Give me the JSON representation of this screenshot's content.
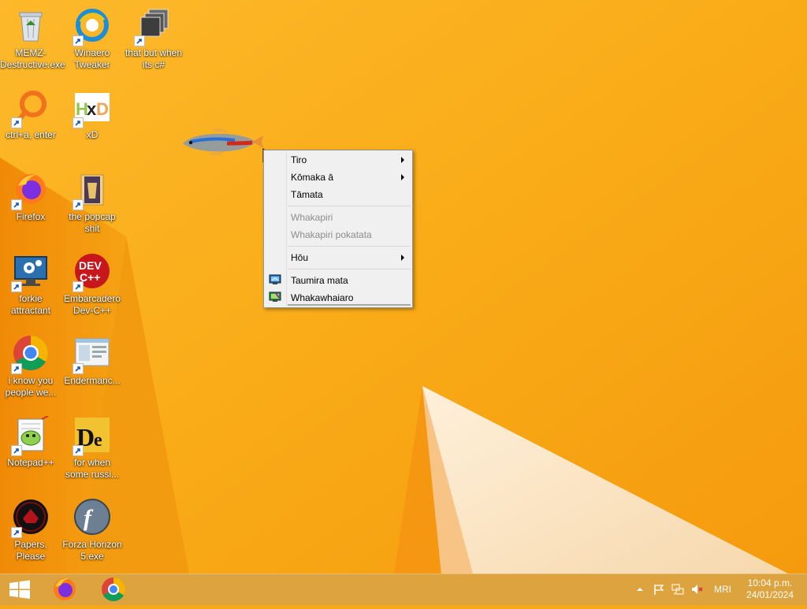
{
  "desktop": {
    "icons": [
      {
        "label": "MEMZ-Destructive.exe",
        "icon": "recycle-bin-icon"
      },
      {
        "label": "Winaero Tweaker",
        "icon": "winaero-icon"
      },
      {
        "label": "that but when its c#",
        "icon": "stacked-windows-icon"
      },
      {
        "label": "ctrl+a, enter",
        "icon": "magnifier-ring-icon"
      },
      {
        "label": "xD",
        "icon": "hxd-icon"
      },
      {
        "label": "Firefox",
        "icon": "firefox-icon"
      },
      {
        "label": "the popcap shit",
        "icon": "folder-icon"
      },
      {
        "label": "forkie attractant",
        "icon": "monitor-gear-icon"
      },
      {
        "label": "Embarcadero Dev-C++",
        "icon": "devcpp-icon"
      },
      {
        "label": "i know you people we...",
        "icon": "chrome-icon"
      },
      {
        "label": "Endermanc...",
        "icon": "window-app-icon"
      },
      {
        "label": "Notepad++",
        "icon": "notepadpp-icon"
      },
      {
        "label": "for when some russi...",
        "icon": "de-icon"
      },
      {
        "label": "Papers, Please",
        "icon": "papers-please-icon"
      },
      {
        "label": "Forza Horizon 5.exe",
        "icon": "flash-icon"
      }
    ]
  },
  "context_menu": {
    "items": [
      {
        "label": "Tiro",
        "submenu": true,
        "enabled": true
      },
      {
        "label": "Kōmaka ā",
        "submenu": true,
        "enabled": true
      },
      {
        "label": "Tāmata",
        "submenu": false,
        "enabled": true
      },
      {
        "label": "Whakapiri",
        "submenu": false,
        "enabled": false
      },
      {
        "label": "Whakapiri pokatata",
        "submenu": false,
        "enabled": false
      },
      {
        "label": "Hōu",
        "submenu": true,
        "enabled": true
      },
      {
        "label": "Taumira mata",
        "submenu": false,
        "enabled": true,
        "icon": "display-settings-icon"
      },
      {
        "label": "Whakawhaiaro",
        "submenu": false,
        "enabled": true,
        "icon": "personalize-icon"
      }
    ]
  },
  "taskbar": {
    "start": "windows-logo-icon",
    "pinned": [
      "firefox-icon",
      "chrome-icon"
    ],
    "tray": {
      "icons": [
        "show-hidden-icons-chevron",
        "action-center-flag-icon",
        "network-icon",
        "volume-muted-icon"
      ],
      "language": "MRI",
      "time": "10:04 p.m.",
      "date": "24/01/2024"
    }
  },
  "colors": {
    "wallpaper": "#f7a81a",
    "taskbar": "#dca33e",
    "menu_bg": "#f0f0f0"
  }
}
